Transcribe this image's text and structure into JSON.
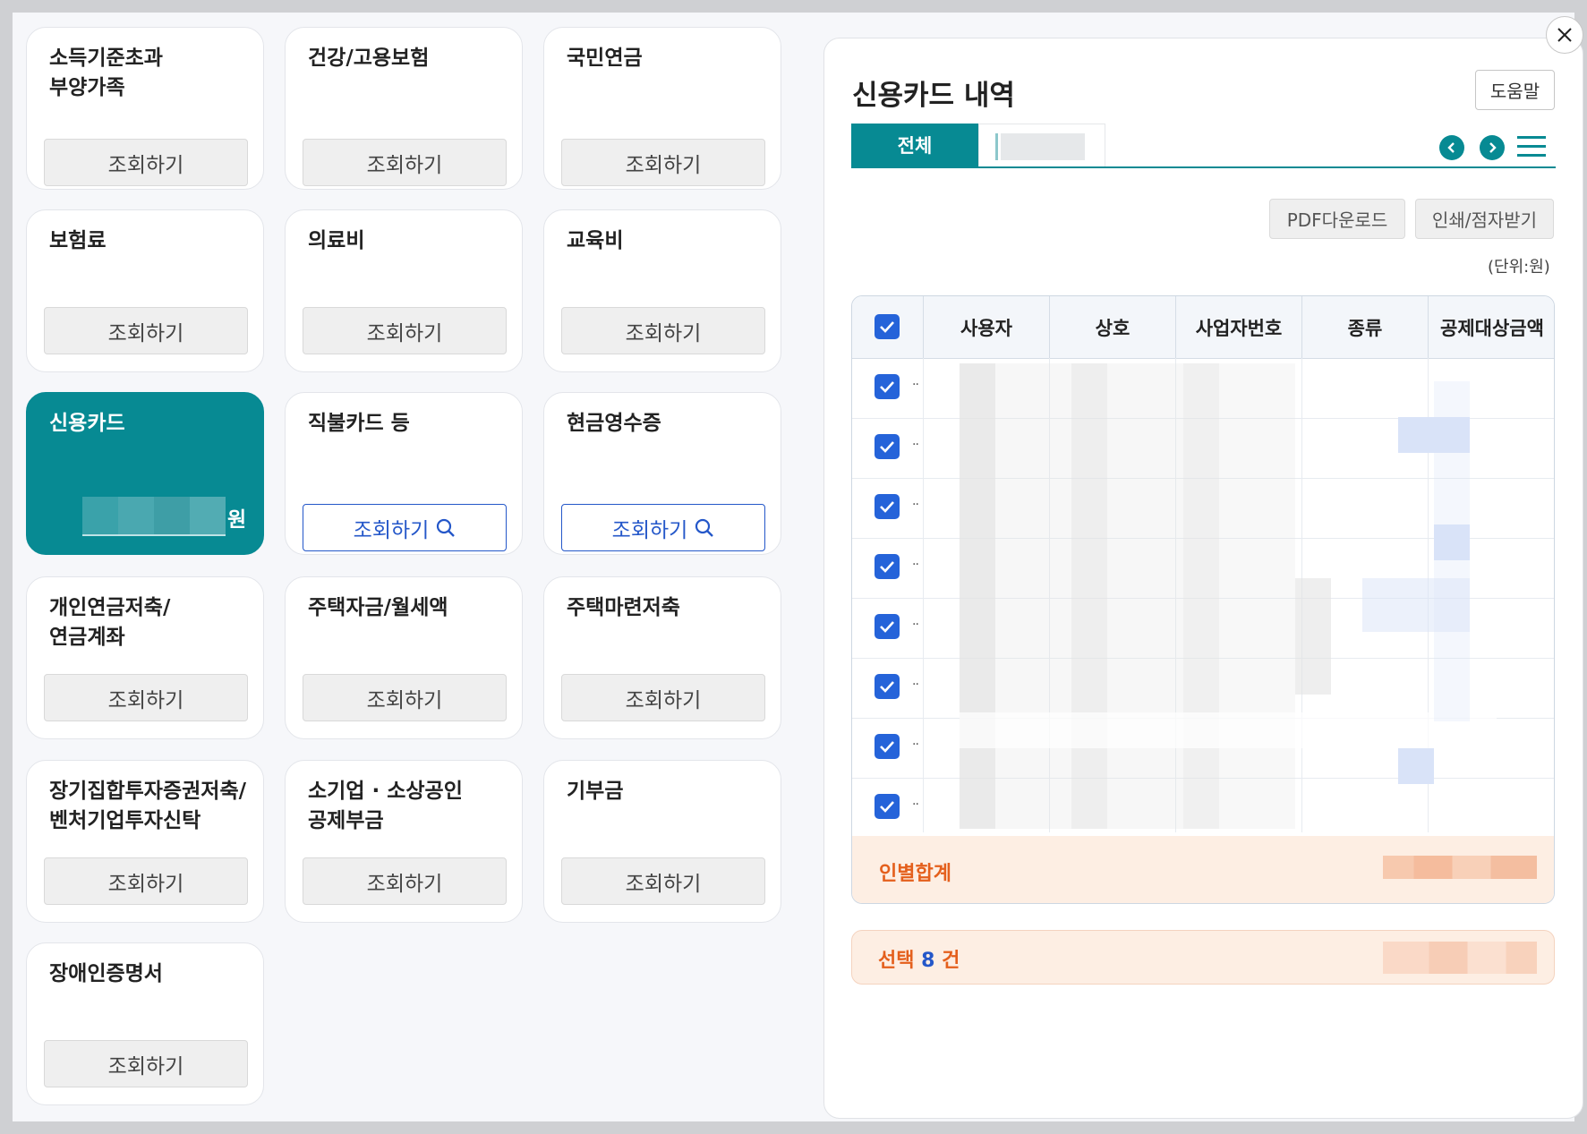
{
  "close_icon": "close-icon",
  "cards": [
    {
      "id": "income-dependents",
      "title": "소득기준초과\n부양가족",
      "button": "조회하기"
    },
    {
      "id": "health-employment",
      "title": "건강/고용보험",
      "button": "조회하기"
    },
    {
      "id": "national-pension",
      "title": "국민연금",
      "button": "조회하기"
    },
    {
      "id": "insurance",
      "title": "보험료",
      "button": "조회하기"
    },
    {
      "id": "medical",
      "title": "의료비",
      "button": "조회하기"
    },
    {
      "id": "education",
      "title": "교육비",
      "button": "조회하기"
    },
    {
      "id": "credit-card",
      "title": "신용카드",
      "suffix": "원"
    },
    {
      "id": "debit-card",
      "title": "직불카드 등",
      "button": "조회하기"
    },
    {
      "id": "cash-receipt",
      "title": "현금영수증",
      "button": "조회하기"
    },
    {
      "id": "personal-pension",
      "title": "개인연금저축/\n연금계좌",
      "button": "조회하기"
    },
    {
      "id": "housing-fund",
      "title": "주택자금/월세액",
      "button": "조회하기"
    },
    {
      "id": "housing-savings",
      "title": "주택마련저축",
      "button": "조회하기"
    },
    {
      "id": "long-term-investment",
      "title": "장기집합투자증권저축/\n벤처기업투자신탁",
      "button": "조회하기"
    },
    {
      "id": "small-business",
      "title": "소기업 · 소상공인\n공제부금",
      "button": "조회하기"
    },
    {
      "id": "donation",
      "title": "기부금",
      "button": "조회하기"
    },
    {
      "id": "disability-cert",
      "title": "장애인증명서",
      "button": "조회하기"
    }
  ],
  "panel": {
    "title": "신용카드 내역",
    "help_button": "도움말",
    "tabs": [
      {
        "label": "전체"
      }
    ],
    "pdf_button": "PDF다운로드",
    "print_button": "인쇄/점자받기",
    "unit": "(단위:원)",
    "table": {
      "headers": [
        "사용자",
        "상호",
        "사업자번호",
        "종류",
        "공제대상금액"
      ],
      "row_dots": [
        "··",
        "··",
        "··",
        "··",
        "··",
        "··",
        "··",
        "··"
      ]
    },
    "sum_label": "인별합계",
    "selection": {
      "prefix": "선택",
      "count": "8",
      "suffix": "건"
    }
  },
  "colors": {
    "teal": "#078a93",
    "blue": "#2457c9",
    "checkbox": "#2563d9",
    "orange": "#e45f1c",
    "summary_bg": "#fdeee3"
  }
}
